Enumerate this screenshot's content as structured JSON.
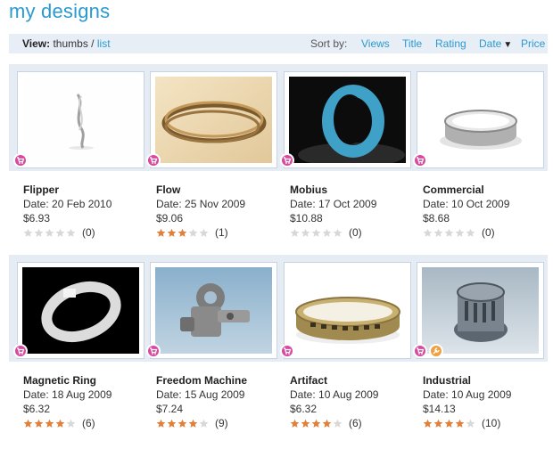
{
  "page": {
    "title": "my designs"
  },
  "toolbar": {
    "view_label": "View:",
    "view_thumbs": "thumbs",
    "view_sep": "/",
    "view_list": "list",
    "sort_label": "Sort by:",
    "sort_options": [
      "Views",
      "Title",
      "Rating",
      "Date",
      "Price"
    ],
    "sort_active_arrow": "▼"
  },
  "colors": {
    "accent": "#2a9ad0",
    "band": "#e6ecf4",
    "star_on": "#e0803a",
    "star_off": "#d8d8d8",
    "cart_badge": "#d64aa0",
    "wrench_badge": "#f0a040"
  },
  "designs": [
    {
      "name": "Flipper",
      "date": "Date: 20 Feb 2010",
      "price": "$6.93",
      "rating": 0,
      "count": "(0)",
      "badges": [
        "cart-icon"
      ]
    },
    {
      "name": "Flow",
      "date": "Date: 25 Nov 2009",
      "price": "$9.06",
      "rating": 3,
      "count": "(1)",
      "badges": [
        "cart-icon"
      ]
    },
    {
      "name": "Mobius",
      "date": "Date: 17 Oct 2009",
      "price": "$10.88",
      "rating": 0,
      "count": "(0)",
      "badges": [
        "cart-icon"
      ]
    },
    {
      "name": "Commercial",
      "date": "Date: 10 Oct 2009",
      "price": "$8.68",
      "rating": 0,
      "count": "(0)",
      "badges": [
        "cart-icon"
      ]
    },
    {
      "name": "Magnetic Ring",
      "date": "Date: 18 Aug 2009",
      "price": "$6.32",
      "rating": 4,
      "count": "(6)",
      "badges": [
        "cart-icon"
      ]
    },
    {
      "name": "Freedom Machine",
      "date": "Date: 15 Aug 2009",
      "price": "$7.24",
      "rating": 4,
      "count": "(9)",
      "badges": [
        "cart-icon"
      ]
    },
    {
      "name": "Artifact",
      "date": "Date: 10 Aug 2009",
      "price": "$6.32",
      "rating": 4,
      "count": "(6)",
      "badges": [
        "cart-icon"
      ]
    },
    {
      "name": "Industrial",
      "date": "Date: 10 Aug 2009",
      "price": "$14.13",
      "rating": 4,
      "count": "(10)",
      "badges": [
        "cart-icon",
        "wrench-icon"
      ]
    }
  ]
}
